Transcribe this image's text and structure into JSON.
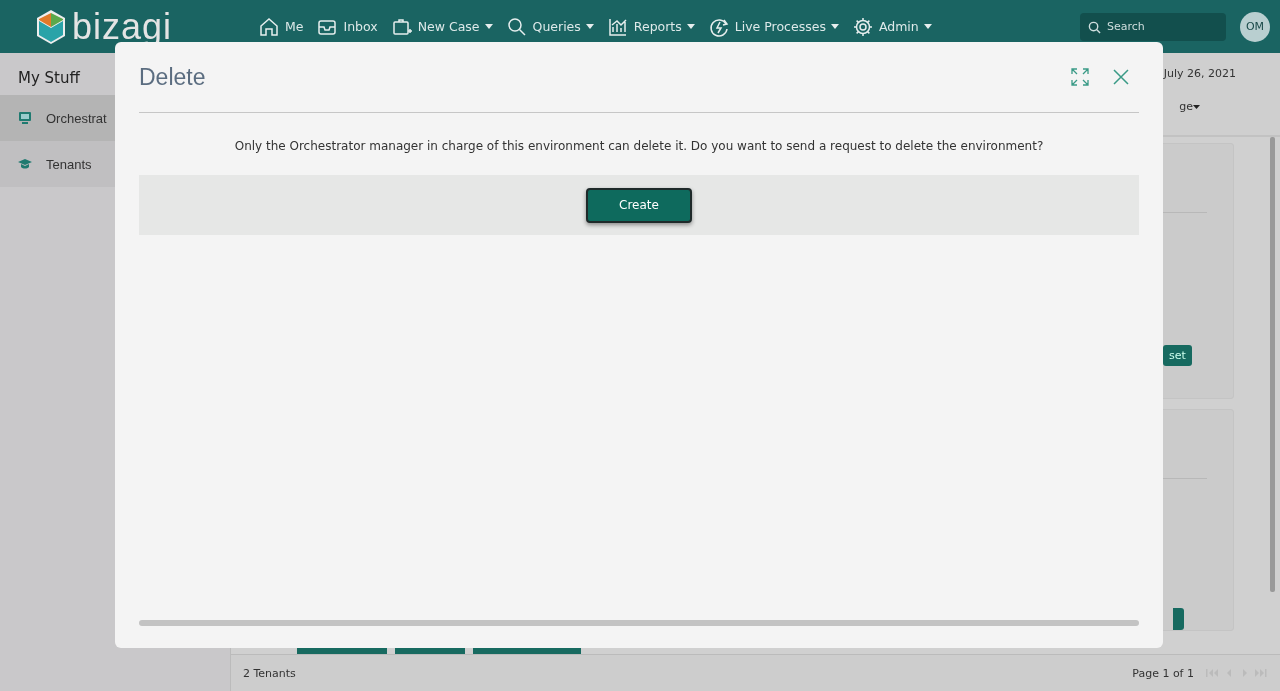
{
  "header": {
    "logo": "bizagi",
    "nav": [
      {
        "label": "Me",
        "dropdown": false
      },
      {
        "label": "Inbox",
        "dropdown": false
      },
      {
        "label": "New Case",
        "dropdown": true
      },
      {
        "label": "Queries",
        "dropdown": true
      },
      {
        "label": "Reports",
        "dropdown": true
      },
      {
        "label": "Live Processes",
        "dropdown": true
      },
      {
        "label": "Admin",
        "dropdown": true
      }
    ],
    "search": {
      "placeholder": "Search"
    },
    "avatar": "OM"
  },
  "sidebar": {
    "title": "My Stuff",
    "items": [
      {
        "label": "Orchestrat",
        "selected": true
      },
      {
        "label": "Tenants",
        "selected": false
      }
    ]
  },
  "background": {
    "date": "July 26, 2021",
    "menu": "ge",
    "reset_button": "set"
  },
  "status_bar": {
    "count": "2 Tenants",
    "page": "Page 1 of 1"
  },
  "dialog": {
    "title": "Delete",
    "message": "Only the Orchestrator manager in charge of this environment can delete it. Do you want to send a request to delete the environment?",
    "button": "Create"
  }
}
